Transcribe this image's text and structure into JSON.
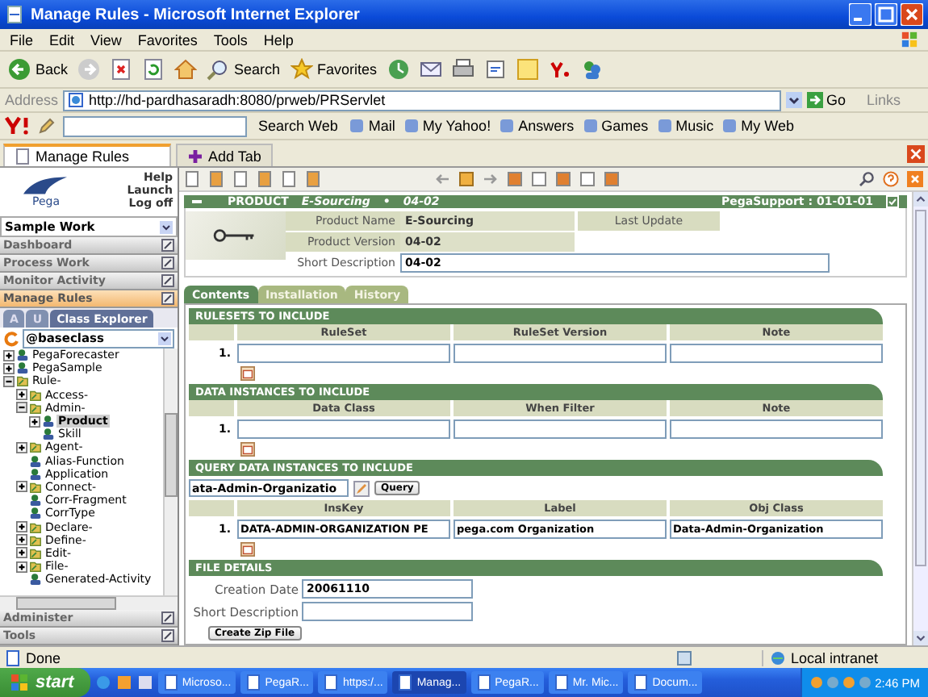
{
  "window": {
    "title": "Manage Rules - Microsoft Internet Explorer"
  },
  "menu": [
    "File",
    "Edit",
    "View",
    "Favorites",
    "Tools",
    "Help"
  ],
  "toolbar": {
    "back": "Back",
    "search": "Search",
    "favorites": "Favorites"
  },
  "address": {
    "label": "Address",
    "value": "http://hd-pardhasaradh:8080/prweb/PRServlet",
    "go": "Go",
    "links": "Links"
  },
  "yahoo_toolbar": {
    "search_button": "Search Web",
    "items": [
      "Mail",
      "My Yahoo!",
      "Answers",
      "Games",
      "Music",
      "My Web"
    ]
  },
  "browser_tabs": [
    {
      "label": "Manage Rules",
      "kind": "page",
      "selected": true
    },
    {
      "label": "Add Tab",
      "kind": "add",
      "selected": false
    }
  ],
  "portal": {
    "links": [
      "Help",
      "Launch",
      "Log off"
    ],
    "logo": "Pega",
    "workpool": "Sample Work",
    "nav": [
      {
        "label": "Dashboard",
        "selected": false
      },
      {
        "label": "Process Work",
        "selected": false
      },
      {
        "label": "Monitor Activity",
        "selected": false
      },
      {
        "label": "Manage Rules",
        "selected": true
      }
    ],
    "explorer_tabs": [
      {
        "label": "A",
        "selected": false
      },
      {
        "label": "U",
        "selected": false
      },
      {
        "label": "Class Explorer",
        "selected": true
      }
    ],
    "class_field": "@baseclass",
    "tree": [
      {
        "label": "PegaForecaster",
        "kind": "class",
        "expanded": false,
        "selected": false
      },
      {
        "label": "PegaSample",
        "kind": "class",
        "expanded": false,
        "selected": false
      },
      {
        "label": "Rule-",
        "kind": "group",
        "expanded": true,
        "selected": false,
        "children": [
          {
            "label": "Access-",
            "kind": "group",
            "expanded": false,
            "selected": false
          },
          {
            "label": "Admin-",
            "kind": "group",
            "expanded": true,
            "selected": false,
            "children": [
              {
                "label": "Product",
                "kind": "class",
                "expanded": false,
                "selected": true
              },
              {
                "label": "Skill",
                "kind": "leaf",
                "selected": false
              }
            ]
          },
          {
            "label": "Agent-",
            "kind": "group",
            "expanded": false,
            "selected": false
          },
          {
            "label": "Alias-Function",
            "kind": "leaf",
            "selected": false
          },
          {
            "label": "Application",
            "kind": "leaf",
            "selected": false
          },
          {
            "label": "Connect-",
            "kind": "group",
            "expanded": false,
            "selected": false
          },
          {
            "label": "Corr-Fragment",
            "kind": "leaf",
            "selected": false
          },
          {
            "label": "CorrType",
            "kind": "leaf",
            "selected": false
          },
          {
            "label": "Declare-",
            "kind": "group",
            "expanded": false,
            "selected": false
          },
          {
            "label": "Define-",
            "kind": "group",
            "expanded": false,
            "selected": false
          },
          {
            "label": "Edit-",
            "kind": "group",
            "expanded": false,
            "selected": false
          },
          {
            "label": "File-",
            "kind": "group",
            "expanded": false,
            "selected": false
          },
          {
            "label": "Generated-Activity",
            "kind": "leaf",
            "selected": false
          }
        ]
      }
    ],
    "bottom_nav": [
      "Administer",
      "Tools"
    ]
  },
  "rule": {
    "header": {
      "type": "PRODUCT",
      "name": "E-Sourcing",
      "bullet": "•",
      "version": "04-02",
      "ruleset": "PegaSupport : 01-01-01"
    },
    "info": [
      {
        "label": "Product Name",
        "value": "E-Sourcing"
      },
      {
        "label": "Product Version",
        "value": "04-02"
      }
    ],
    "last_update": "Last Update",
    "short_description": {
      "label": "Short Description",
      "value": "04-02"
    },
    "tabs": [
      {
        "label": "Contents",
        "selected": true
      },
      {
        "label": "Installation",
        "selected": false
      },
      {
        "label": "History",
        "selected": false
      }
    ],
    "sections": [
      {
        "kind": "table",
        "title": "RULESETS TO INCLUDE",
        "columns": [
          "RuleSet",
          "RuleSet Version",
          "Note"
        ],
        "rows": [
          {
            "index": "1."
          }
        ]
      },
      {
        "kind": "table",
        "title": "DATA INSTANCES TO INCLUDE",
        "columns": [
          "Data Class",
          "When Filter",
          "Note"
        ],
        "rows": [
          {
            "index": "1."
          }
        ]
      },
      {
        "kind": "query",
        "title": "QUERY DATA INSTANCES TO INCLUDE",
        "query_value": "ata-Admin-Organizatio",
        "query_button": "Query",
        "columns": [
          "InsKey",
          "Label",
          "Obj Class"
        ],
        "rows": [
          {
            "index": "1.",
            "cells": [
              "DATA-ADMIN-ORGANIZATION PE",
              "pega.com Organization",
              "Data-Admin-Organization"
            ]
          }
        ]
      },
      {
        "kind": "form",
        "title": "FILE DETAILS",
        "fields": [
          {
            "label": "Creation Date",
            "value": "20061110"
          },
          {
            "label": "Short Description"
          }
        ],
        "button": "Create Zip File"
      }
    ]
  },
  "status_bar": {
    "text": "Done",
    "zone": "Local intranet"
  },
  "taskbar": {
    "start": "start",
    "items": [
      {
        "label": "Microso...",
        "selected": false
      },
      {
        "label": "PegaR...",
        "selected": false
      },
      {
        "label": "https:/...",
        "selected": false
      },
      {
        "label": "Manag...",
        "selected": true
      },
      {
        "label": "PegaR...",
        "selected": false
      },
      {
        "label": "Mr. Mic...",
        "selected": false
      },
      {
        "label": "Docum...",
        "selected": false
      }
    ],
    "time": "2:46 PM"
  }
}
